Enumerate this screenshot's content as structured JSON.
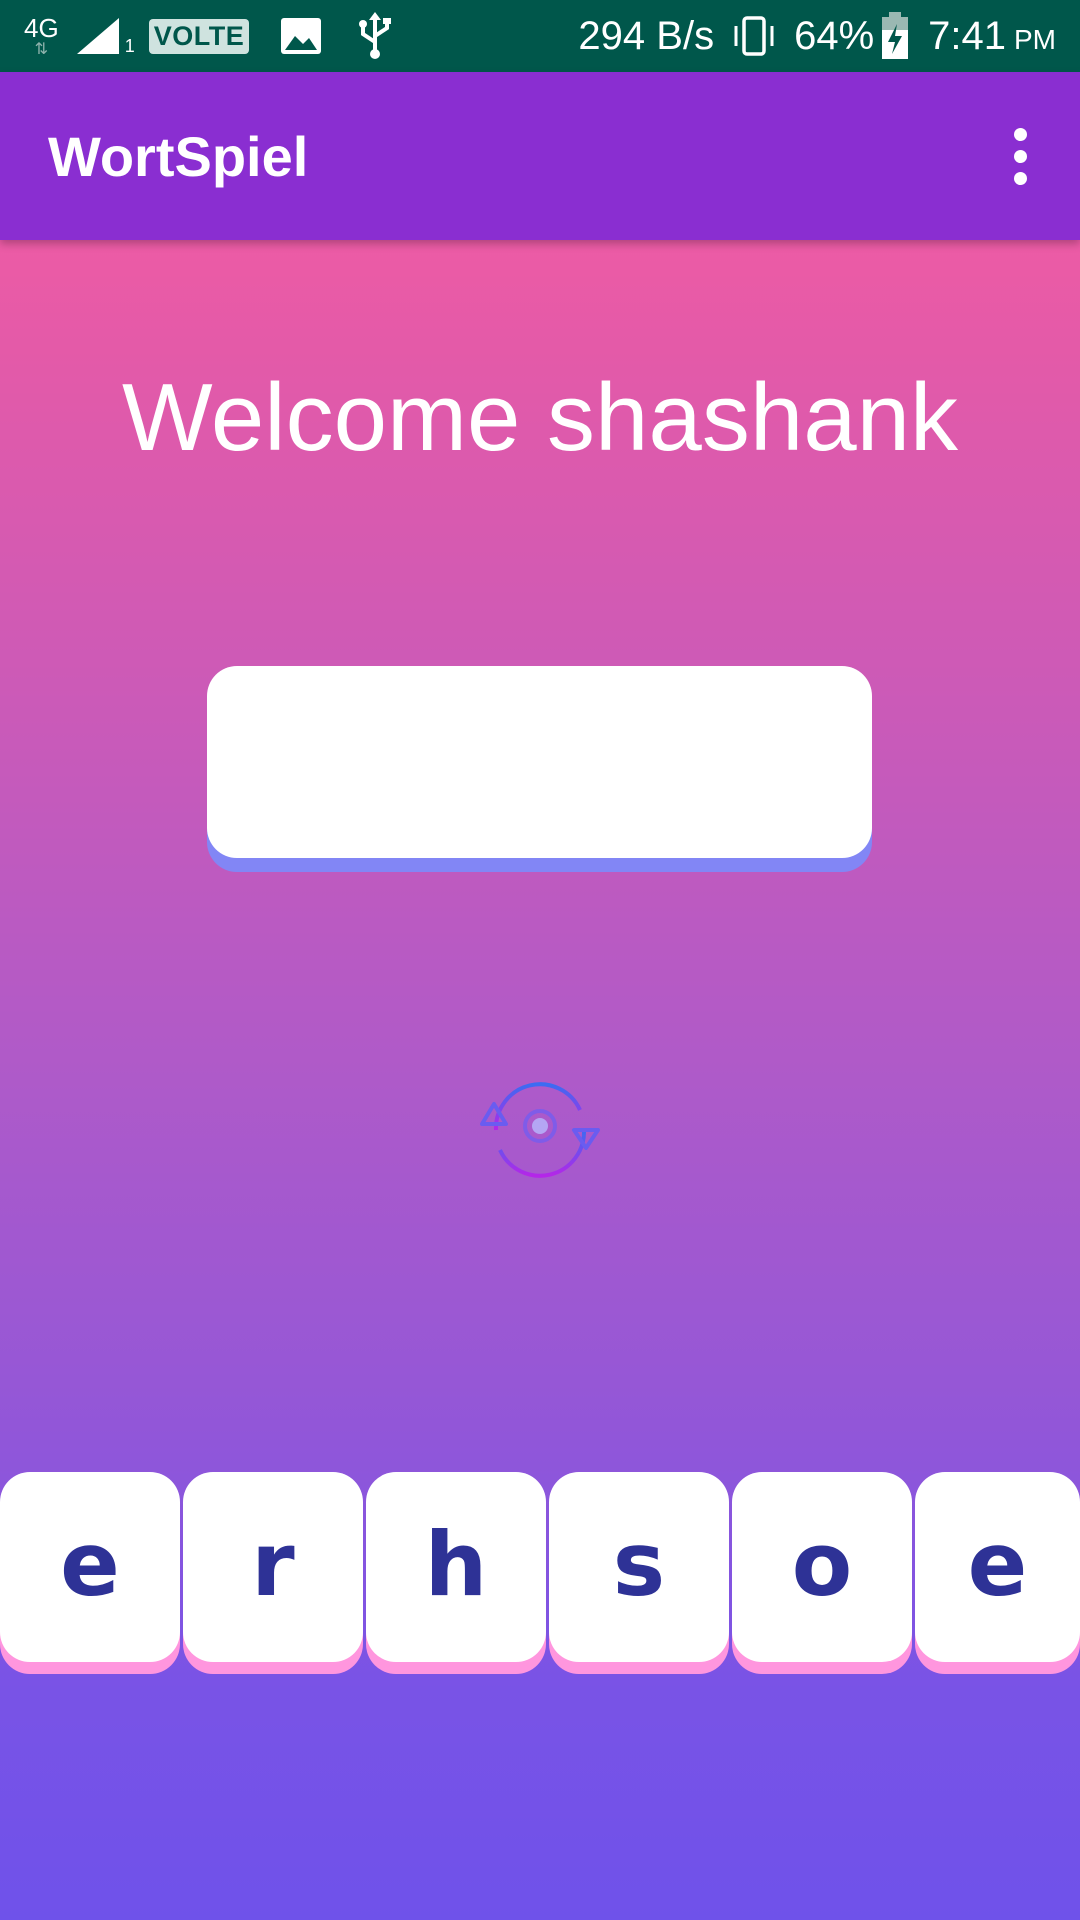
{
  "status_bar": {
    "network_type": "4G",
    "sim_slot": "1",
    "volte": "VOLTE",
    "speed": "294 B/s",
    "battery": "64%",
    "time": "7:41",
    "ampm": "PM"
  },
  "app_bar": {
    "title": "WortSpiel"
  },
  "main": {
    "welcome_text": "Welcome shashank",
    "answer_value": ""
  },
  "tiles": [
    "e",
    "r",
    "h",
    "s",
    "o",
    "e"
  ],
  "colors": {
    "status_bar": "#00574b",
    "app_bar": "#8a2ed1",
    "tile_letter": "#2e3296",
    "tile_shadow": "#ff96de",
    "answer_shadow": "#8286f5",
    "gradient_top": "#ff5fa0",
    "gradient_bottom": "#6f52ea"
  }
}
